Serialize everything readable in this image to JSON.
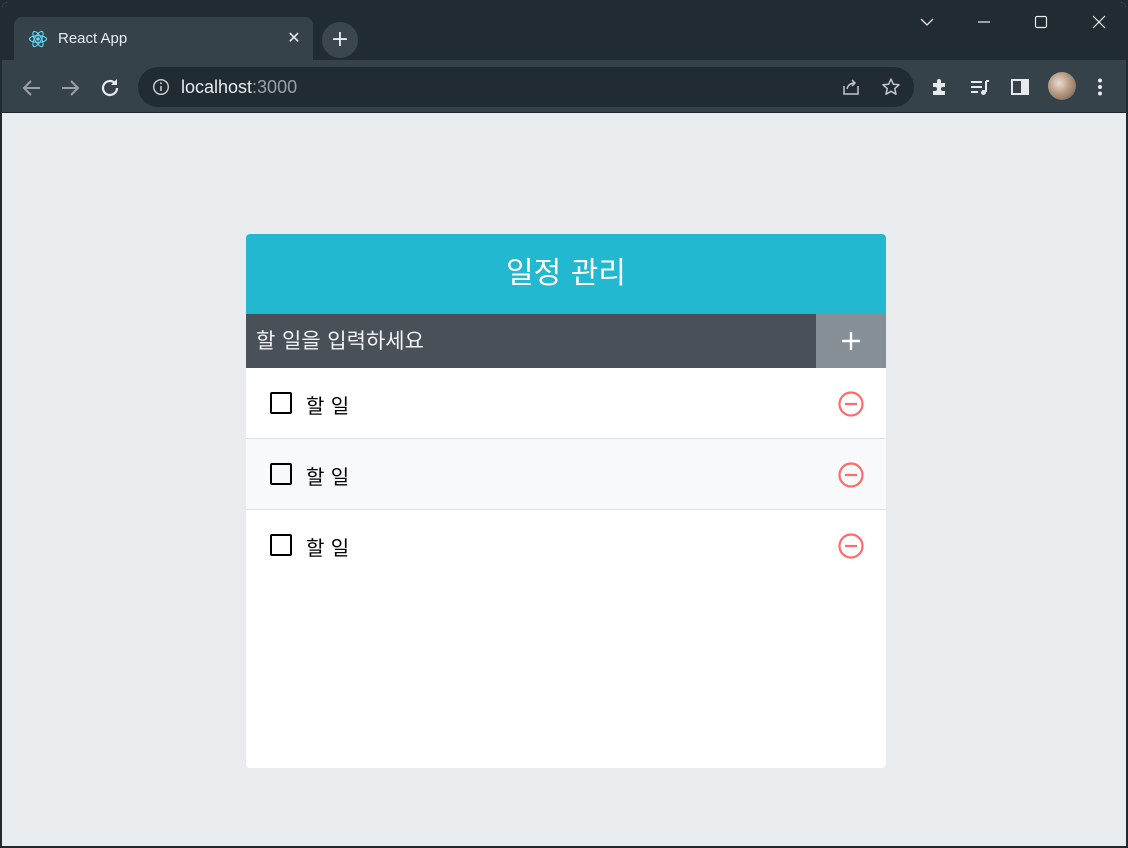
{
  "browser": {
    "tab": {
      "title": "React App",
      "close": "✕"
    },
    "new_tab": "+",
    "address": {
      "host": "localhost",
      "port": ":3000"
    },
    "colors": {
      "frame": "#202b32",
      "toolbar": "#35424a"
    }
  },
  "app": {
    "title": "일정 관리",
    "input": {
      "placeholder": "할 일을 입력하세요",
      "value": ""
    },
    "items": [
      {
        "text": "할 일",
        "checked": false
      },
      {
        "text": "할 일",
        "checked": false
      },
      {
        "text": "할 일",
        "checked": false
      }
    ],
    "colors": {
      "header": "#22b8cf",
      "input_bg": "#495057",
      "add_button": "#868e96",
      "remove": "#ff6b6b"
    }
  },
  "icons": {
    "tab_favicon": "react-logo-icon",
    "back": "arrow-left-icon",
    "forward": "arrow-right-icon",
    "reload": "reload-icon",
    "site_info": "info-icon",
    "share": "share-icon",
    "bookmark": "star-icon",
    "extensions": "puzzle-icon",
    "media": "playlist-icon",
    "side_panel": "side-panel-icon",
    "menu": "kebab-icon",
    "add": "plus-icon",
    "remove": "minus-circle-icon"
  }
}
